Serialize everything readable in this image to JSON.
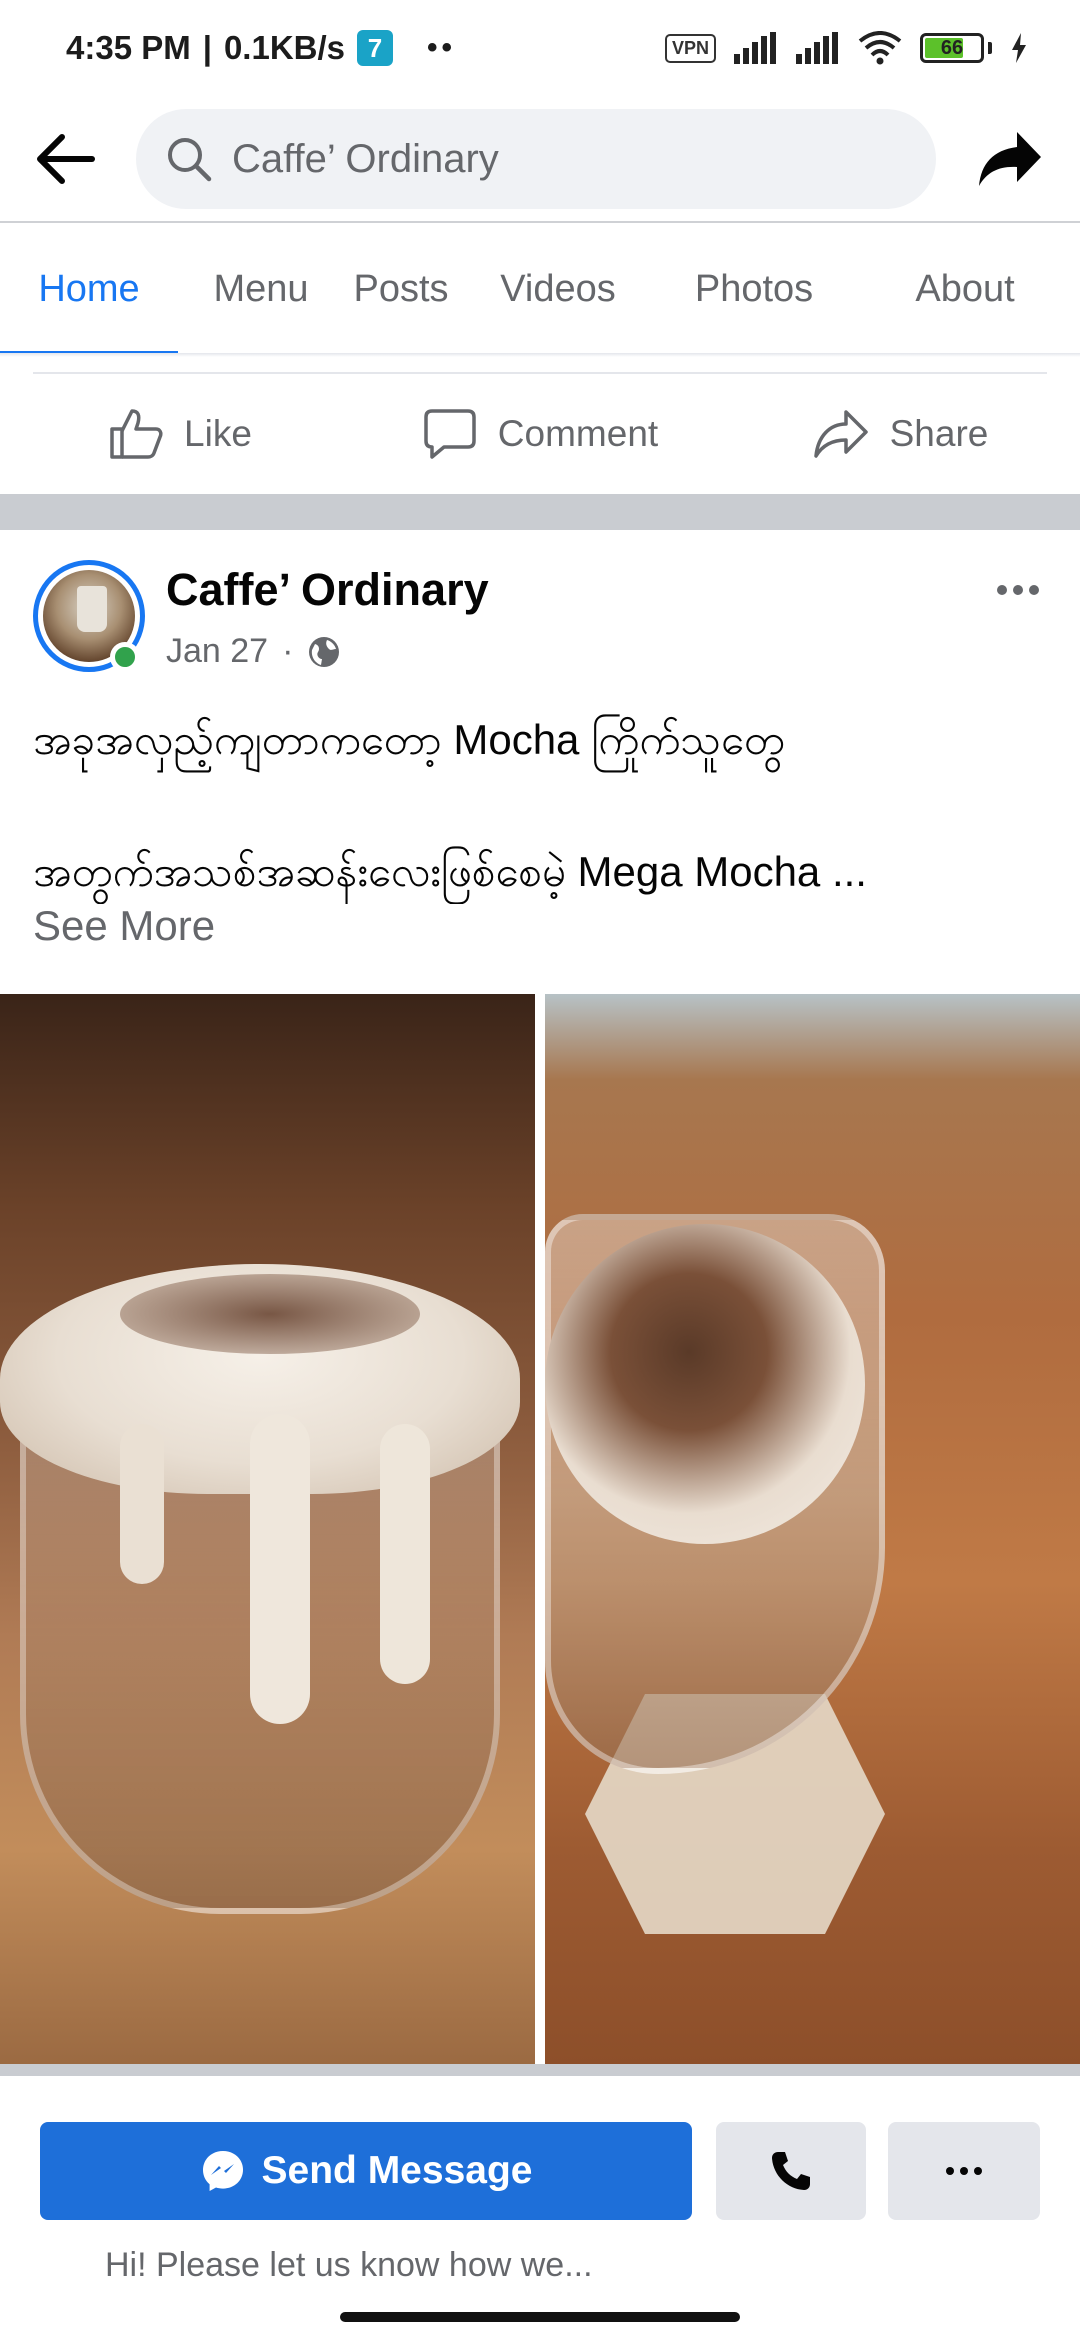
{
  "status_bar": {
    "time": "4:35 PM",
    "speed": "0.1KB/s",
    "app_badge": "7",
    "dots": "••",
    "vpn": "VPN",
    "battery": "66"
  },
  "header": {
    "search_text": "Caffe’ Ordinary"
  },
  "tabs": [
    {
      "label": "Home",
      "active": true
    },
    {
      "label": "Menu"
    },
    {
      "label": "Posts"
    },
    {
      "label": "Videos"
    },
    {
      "label": "Photos"
    },
    {
      "label": "About"
    }
  ],
  "actions": {
    "like": "Like",
    "comment": "Comment",
    "share": "Share"
  },
  "post": {
    "author": "Caffe’ Ordinary",
    "date": "Jan 27",
    "separator": "·",
    "text_line1": "အခုအလှည့်ကျတာကတော့ Mocha ကြိုက်သူတွေ",
    "text_line2": "အတွက်အသစ်အဆန်းလေးဖြစ်စေမဲ့ Mega Mocha ...",
    "see_more": "See More"
  },
  "bottom": {
    "send_message": "Send Message",
    "greeting": "Hi! Please let us know how we..."
  },
  "colors": {
    "accent": "#1877f2",
    "send_button": "#1e6fd9",
    "secondary_button": "#e4e6eb",
    "muted_text": "#65676b",
    "online": "#31a24c"
  }
}
